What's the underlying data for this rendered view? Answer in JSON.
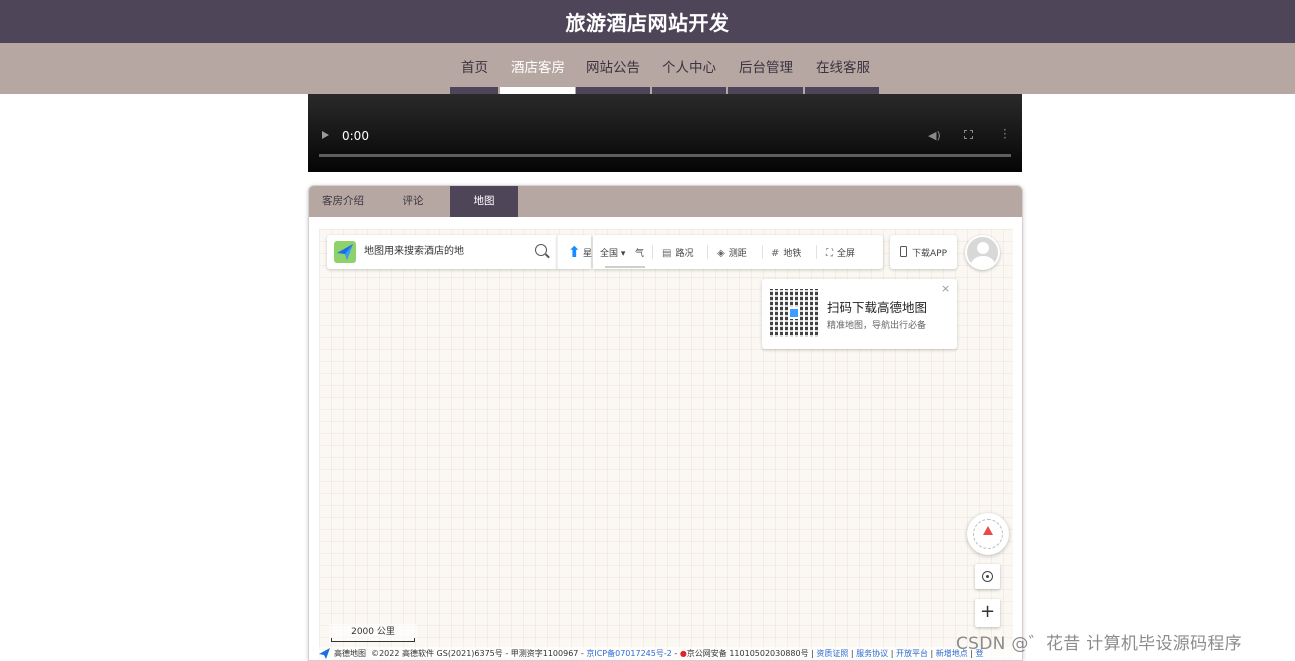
{
  "header": {
    "title": "旅游酒店网站开发"
  },
  "nav": {
    "items": [
      {
        "label": "首页",
        "active": false
      },
      {
        "label": "酒店客房",
        "active": true
      },
      {
        "label": "网站公告",
        "active": false
      },
      {
        "label": "个人中心",
        "active": false
      },
      {
        "label": "后台管理",
        "active": false
      },
      {
        "label": "在线客服",
        "active": false
      }
    ]
  },
  "video": {
    "time": "0:00"
  },
  "tabs": [
    {
      "label": "客房介绍",
      "active": false
    },
    {
      "label": "评论",
      "active": false
    },
    {
      "label": "地图",
      "active": true
    }
  ],
  "map": {
    "search_value": "地图用来搜索酒店的地",
    "toolbar": {
      "star_label": "星",
      "city_label": "全国",
      "weather_label": "气",
      "traffic_label": "路况",
      "ranging_label": "测距",
      "subway_label": "地铁",
      "fullscreen_label": "全屏"
    },
    "app_label": "下载APP",
    "qr": {
      "title": "扫码下载高德地图",
      "subtitle": "精准地图，导航出行必备",
      "close": "×"
    },
    "zoom_in": "+",
    "scale": "2000 公里",
    "footer": {
      "brand": "高德地图",
      "copyright": "©2022 高德软件 GS(2021)6375号 - 甲测资字1100967 - ",
      "icp": "京ICP备07017245号-2",
      "sep1": " - ",
      "police": "京公网安备 11010502030880号",
      "sep2": " | ",
      "link1": "资质证照",
      "sep3": " | ",
      "link2": "服务协议",
      "sep4": " | ",
      "link3": "开放平台",
      "sep5": " | ",
      "link4": "新增地点",
      "sep6": " | ",
      "link5": "登"
    }
  },
  "watermark": "CSDN @゛花昔  计算机毕设源码程序",
  "colors": {
    "header_bg": "#4f4558",
    "nav_bg": "#b7a7a2",
    "active_tab_bg": "#4f4558",
    "map_bg": "#fbf8f3",
    "accent_blue": "#1a8cff"
  }
}
